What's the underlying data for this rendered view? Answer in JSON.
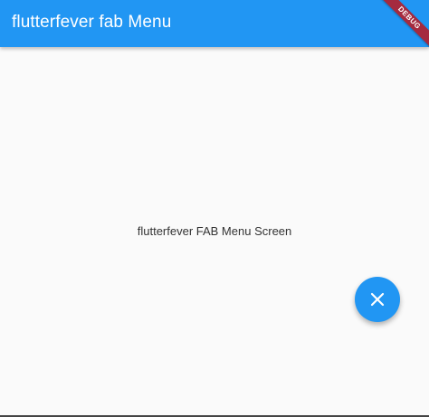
{
  "appbar": {
    "title": "flutterfever fab Menu"
  },
  "debug_banner": {
    "label": "DEBUG"
  },
  "main": {
    "center_text": "flutterfever FAB Menu Screen"
  },
  "fab": {
    "icon": "close-icon"
  },
  "colors": {
    "primary": "#2196f3",
    "background": "#fafafa",
    "debug_banner": "#a52a3f"
  }
}
